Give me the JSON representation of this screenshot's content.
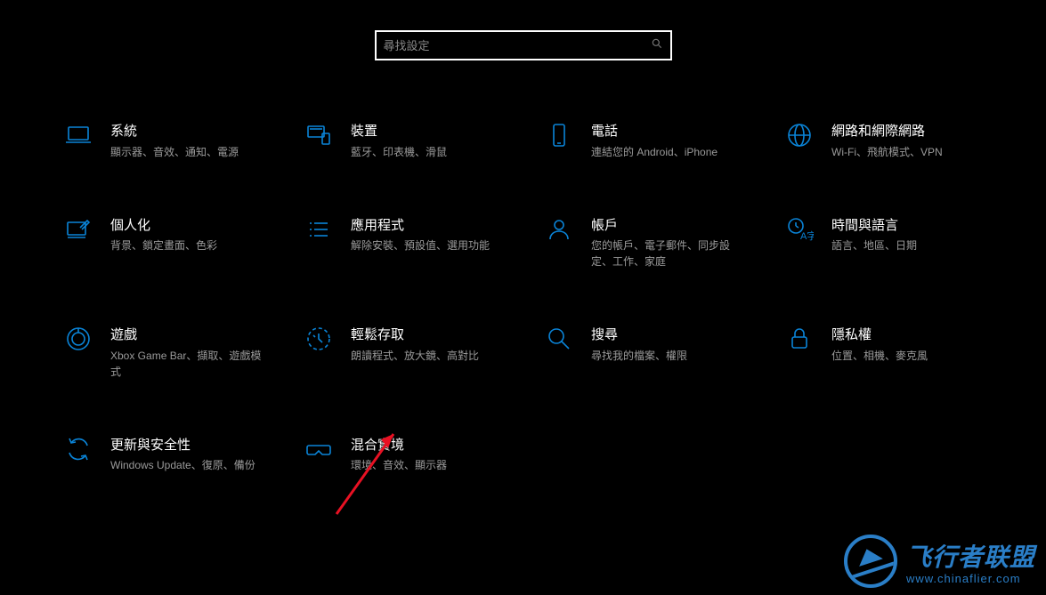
{
  "search": {
    "placeholder": "尋找設定"
  },
  "tiles": [
    {
      "icon": "laptop",
      "title": "系統",
      "desc": "顯示器、音效、通知、電源"
    },
    {
      "icon": "devices",
      "title": "裝置",
      "desc": "藍牙、印表機、滑鼠"
    },
    {
      "icon": "phone",
      "title": "電話",
      "desc": "連結您的 Android、iPhone"
    },
    {
      "icon": "globe",
      "title": "網路和網際網路",
      "desc": "Wi-Fi、飛航模式、VPN"
    },
    {
      "icon": "personalize",
      "title": "個人化",
      "desc": "背景、鎖定畫面、色彩"
    },
    {
      "icon": "apps",
      "title": "應用程式",
      "desc": "解除安裝、預設值、選用功能"
    },
    {
      "icon": "account",
      "title": "帳戶",
      "desc": "您的帳戶、電子郵件、同步設定、工作、家庭"
    },
    {
      "icon": "timelang",
      "title": "時間與語言",
      "desc": "語言、地區、日期"
    },
    {
      "icon": "gaming",
      "title": "遊戲",
      "desc": "Xbox Game Bar、擷取、遊戲模式"
    },
    {
      "icon": "ease",
      "title": "輕鬆存取",
      "desc": "朗讀程式、放大鏡、高對比"
    },
    {
      "icon": "search",
      "title": "搜尋",
      "desc": "尋找我的檔案、權限"
    },
    {
      "icon": "privacy",
      "title": "隱私權",
      "desc": "位置、相機、麥克風"
    },
    {
      "icon": "update",
      "title": "更新與安全性",
      "desc": "Windows Update、復原、備份"
    },
    {
      "icon": "mr",
      "title": "混合實境",
      "desc": "環境、音效、顯示器"
    }
  ],
  "watermark": {
    "name": "飞行者联盟",
    "url": "www.chinaflier.com"
  }
}
